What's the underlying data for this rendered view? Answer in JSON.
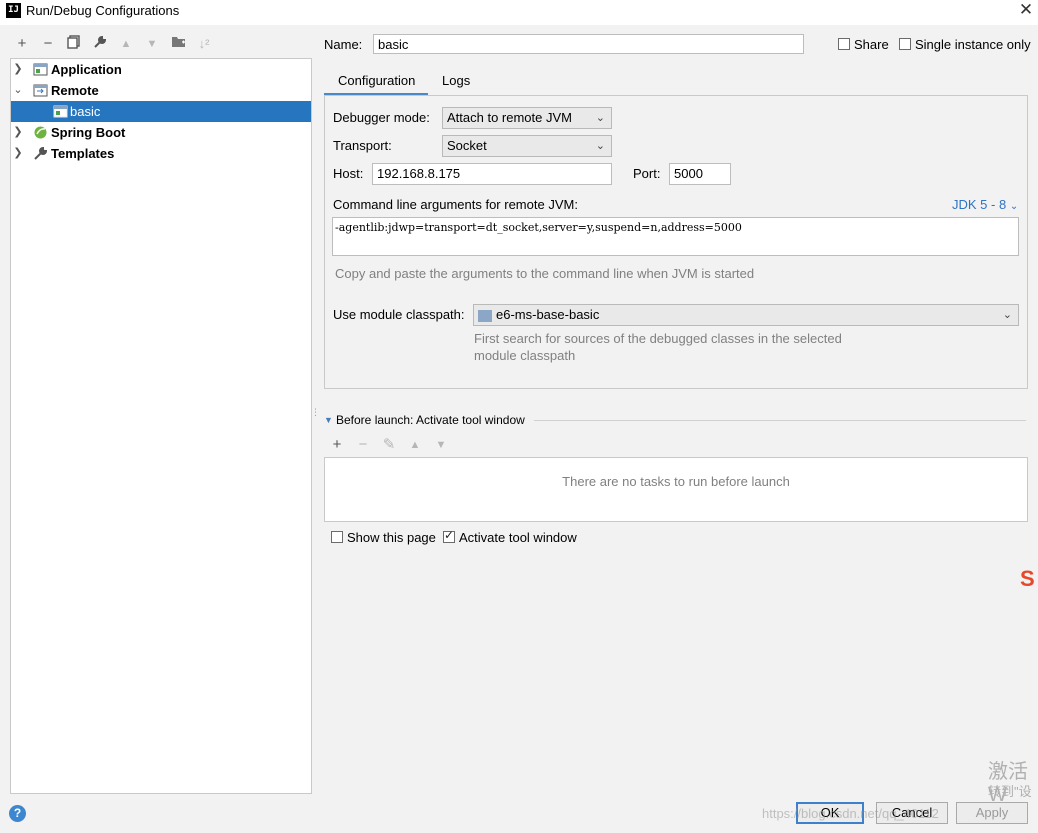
{
  "window": {
    "title": "Run/Debug Configurations",
    "logo_text": "IJ"
  },
  "toolbar": {
    "icons": [
      "add-icon",
      "remove-icon",
      "copy-icon",
      "wrench-icon",
      "move-up-icon",
      "move-down-icon",
      "new-folder-icon",
      "sort-icon"
    ]
  },
  "tree": {
    "items": [
      {
        "label": "Application",
        "expanded": false
      },
      {
        "label": "Remote",
        "expanded": true
      },
      {
        "label": "basic",
        "selected": true
      },
      {
        "label": "Spring Boot",
        "expanded": false
      },
      {
        "label": "Templates",
        "expanded": false
      }
    ]
  },
  "header": {
    "name_label": "Name:",
    "name_value": "basic",
    "share_label": "Share",
    "single_instance_label": "Single instance only"
  },
  "tabs": [
    {
      "label": "Configuration",
      "active": true
    },
    {
      "label": "Logs",
      "active": false
    }
  ],
  "config": {
    "debugger_mode_label": "Debugger mode:",
    "debugger_mode_value": "Attach to remote JVM",
    "transport_label": "Transport:",
    "transport_value": "Socket",
    "host_label": "Host:",
    "host_value": "192.168.8.175",
    "port_label": "Port:",
    "port_value": "5000",
    "cmd_label": "Command line arguments for remote JVM:",
    "jdk_link": "JDK 5 - 8",
    "cmd_value": "-agentlib:jdwp=transport=dt_socket,server=y,suspend=n,address=5000",
    "cmd_hint": "Copy and paste the arguments to the command line when JVM is started",
    "module_label": "Use module classpath:",
    "module_value": "e6-ms-base-basic",
    "module_hint_1": "First search for sources of the debugged classes in the selected",
    "module_hint_2": "module classpath"
  },
  "before_launch": {
    "title": "Before launch: Activate tool window",
    "empty_text": "There are no tasks to run before launch",
    "show_page_label": "Show this page",
    "activate_tool_label": "Activate tool window"
  },
  "buttons": {
    "ok": "OK",
    "cancel": "Cancel",
    "apply": "Apply"
  },
  "overlays": {
    "activate_1": "激活 W",
    "activate_2": "转到\"设",
    "url": "https://blog.csdn.net/qq_40112"
  },
  "colors": {
    "selection": "#2675bf",
    "link": "#2f73c4",
    "accent": "#4a88c7"
  }
}
